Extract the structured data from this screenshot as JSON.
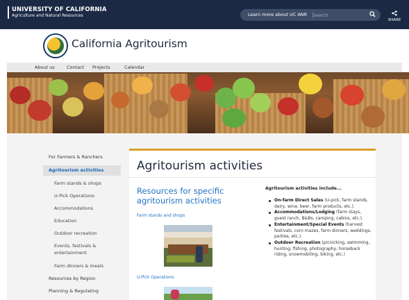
{
  "header": {
    "org_line1": "UNIVERSITY OF CALIFORNIA",
    "org_line2": "Agriculture and Natural Resources",
    "learn_more": "Learn more about UC ANR",
    "search_placeholder": "Search",
    "share_label": "SHARE",
    "search_icon": "search-icon",
    "share_icon": "share-icon"
  },
  "brand": {
    "title": "California Agritourism",
    "logo_icon": "seal-logo"
  },
  "nav": {
    "items": [
      "About us",
      "Contact",
      "Projects",
      "Calendar"
    ]
  },
  "sidebar": {
    "items": [
      {
        "label": "For Farmers & Ranchers"
      },
      {
        "label": "Agritourism activities"
      },
      {
        "label": "Farm stands & shops"
      },
      {
        "label": "U-Pick Operations"
      },
      {
        "label": "Accommodations"
      },
      {
        "label": "Education"
      },
      {
        "label": "Outdoor recreation"
      },
      {
        "label": "Events, festivals &"
      },
      {
        "label": "entertainment"
      },
      {
        "label": "Farm dinners & meals"
      },
      {
        "label": "Resources by Region"
      },
      {
        "label": "Planning & Regulating"
      }
    ]
  },
  "main": {
    "title": "Agritourism activities",
    "resources_title": "Resources for specific agritourism activities",
    "link_farm_stands": "Farm stands and shops",
    "link_upick": "U-Pick Operations",
    "include_heading": "Agritourism activities include...",
    "bullets": [
      {
        "title": "On-farm Direct Sales",
        "text": " (U-pick, farm stands, dairy, wine, beer, farm products, etc.)."
      },
      {
        "title": "Accommodations/Lodging",
        "text": " (farm stays, guest ranch, B&Bs, camping, cabins, etc.)."
      },
      {
        "title": "Entertainment/Special Events",
        "text": " (harvest festivals, corn mazes, farm dinners, weddings, parties, etc.)."
      },
      {
        "title": "Outdoor Recreation",
        "text": " (picnicking, swimming, hunting, fishing, photography, horseback riding, snowmobiling, biking, etc.)"
      }
    ]
  },
  "colors": {
    "topbar": "#1b2944",
    "accent_gold": "#d89f2a",
    "link_blue": "#1f73c4"
  }
}
